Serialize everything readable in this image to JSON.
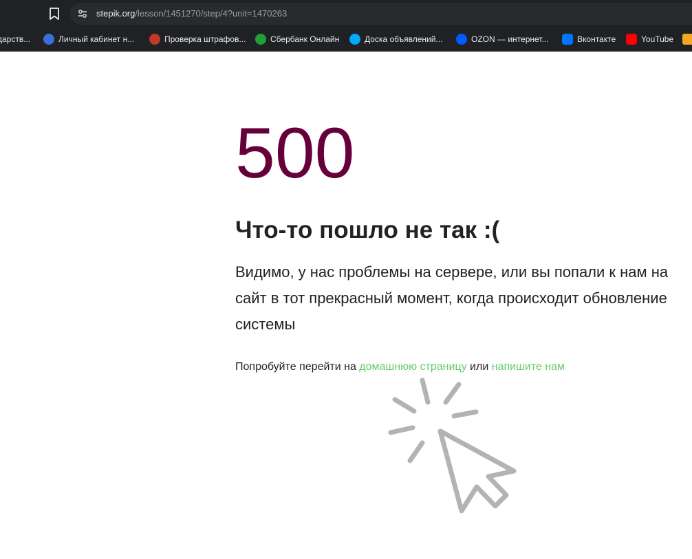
{
  "browser": {
    "url_host": "stepik.org",
    "url_path": "/lesson/1451270/step/4?unit=1470263",
    "bookmarks": [
      {
        "label": "дарств...",
        "color": "#888888"
      },
      {
        "label": "Личный кабинет н...",
        "color": "#3b6fd8"
      },
      {
        "label": "Проверка штрафов...",
        "color": "#c0392b"
      },
      {
        "label": "Сбербанк Онлайн",
        "color": "#21a038"
      },
      {
        "label": "Доска объявлений...",
        "color": "#00aaff"
      },
      {
        "label": "OZON — интернет...",
        "color": "#005bff"
      },
      {
        "label": "Вконтакте",
        "color": "#0077ff"
      },
      {
        "label": "YouTube",
        "color": "#ff0000"
      }
    ]
  },
  "error": {
    "code": "500",
    "title": "Что-то пошло не так :(",
    "description": "Видимо, у нас проблемы на сервере, или вы попали к нам на сайт в тот прекрасный момент, когда происходит обновление системы",
    "hint_prefix": "Попробуйте перейти на ",
    "home_link": "домашнюю страницу",
    "hint_or": " или ",
    "contact_link": "напишите нам"
  },
  "colors": {
    "code": "#66003a",
    "link": "#66cc66",
    "illustration": "#b3b3b3"
  },
  "icons": {
    "bookmark": "bookmark-icon",
    "site_info": "tune-icon",
    "illustration": "cursor-click-icon"
  }
}
